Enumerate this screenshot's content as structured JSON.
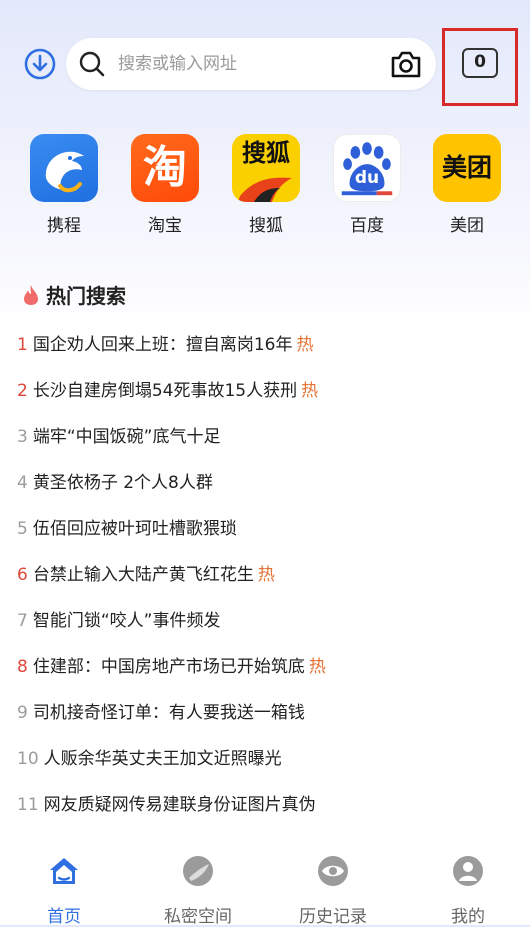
{
  "search": {
    "placeholder": "搜索或输入网址"
  },
  "tabs": {
    "count": "0"
  },
  "apps": [
    {
      "label": "携程",
      "icon": "ctrip-dolphin-icon"
    },
    {
      "label": "淘宝",
      "icon": "taobao-icon",
      "glyph": "淘"
    },
    {
      "label": "搜狐",
      "icon": "sohu-fox-icon",
      "glyph": "搜狐"
    },
    {
      "label": "百度",
      "icon": "baidu-paw-icon",
      "glyph": "du"
    },
    {
      "label": "美团",
      "icon": "meituan-icon",
      "glyph": "美团"
    }
  ],
  "hot": {
    "title": "热门搜索",
    "items": [
      {
        "num": "1",
        "text": "国企劝人回来上班：擅自离岗16年",
        "tag": "热"
      },
      {
        "num": "2",
        "text": "长沙自建房倒塌54死事故15人获刑",
        "tag": "热"
      },
      {
        "num": "3",
        "text": "端牢“中国饭碗”底气十足",
        "tag": ""
      },
      {
        "num": "4",
        "text": "黄圣依杨子 2个人8人群",
        "tag": ""
      },
      {
        "num": "5",
        "text": "伍佰回应被叶珂吐槽歌猥琐",
        "tag": ""
      },
      {
        "num": "6",
        "text": "台禁止输入大陆产黄飞红花生",
        "tag": "热"
      },
      {
        "num": "7",
        "text": "智能门锁“咬人”事件频发",
        "tag": ""
      },
      {
        "num": "8",
        "text": "住建部：中国房地产市场已开始筑底",
        "tag": "热"
      },
      {
        "num": "9",
        "text": "司机接奇怪订单：有人要我送一箱钱",
        "tag": ""
      },
      {
        "num": "10",
        "text": "人贩余华英丈夫王加文近照曝光",
        "tag": ""
      },
      {
        "num": "11",
        "text": "网友质疑网传易建联身份证图片真伪",
        "tag": ""
      }
    ]
  },
  "nav": [
    {
      "label": "首页",
      "icon": "home-icon"
    },
    {
      "label": "私密空间",
      "icon": "private-space-icon"
    },
    {
      "label": "历史记录",
      "icon": "history-eye-icon"
    },
    {
      "label": "我的",
      "icon": "profile-icon"
    }
  ],
  "colors": {
    "accent": "#2f6fe0",
    "hot_rank": "#e0473a",
    "hot_tag": "#e57335",
    "highlight_box": "#d72b2b"
  }
}
